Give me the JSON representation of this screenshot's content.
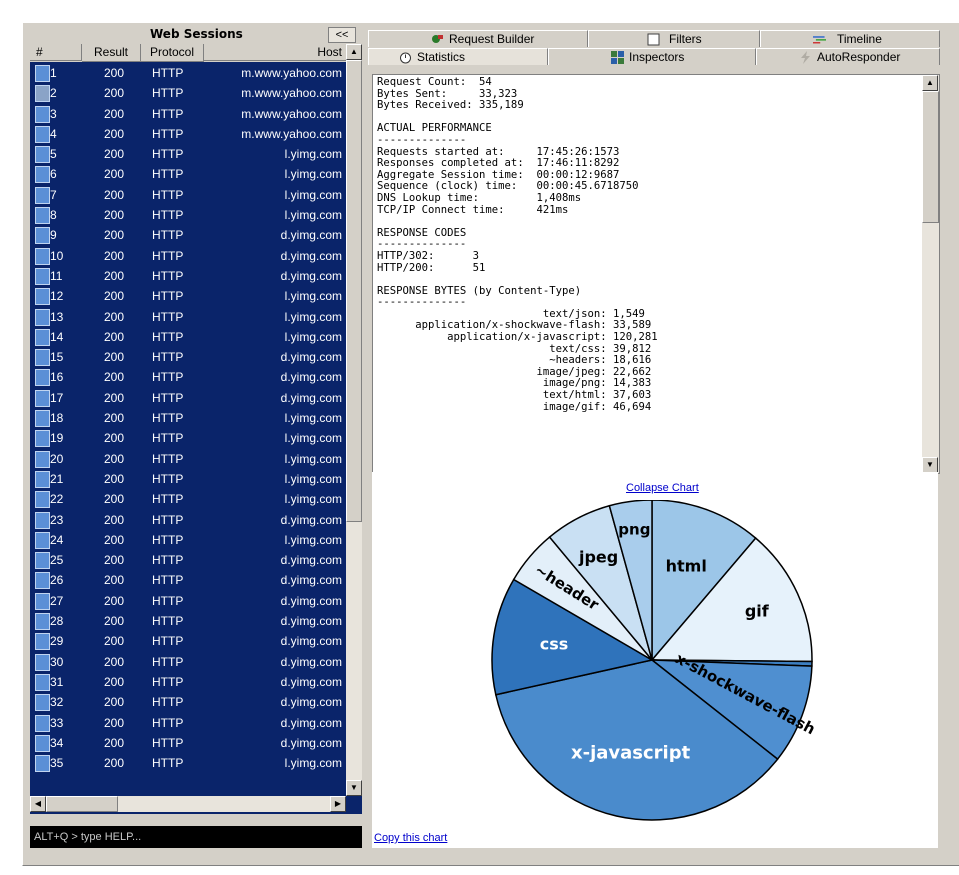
{
  "left_pane": {
    "title": "Web Sessions",
    "collapse_label": "<<",
    "columns": [
      "#",
      "Result",
      "Protocol",
      "Host"
    ],
    "rows": [
      {
        "num": "1",
        "result": "200",
        "protocol": "HTTP",
        "host": "m.www.yahoo.com"
      },
      {
        "num": "2",
        "result": "200",
        "protocol": "HTTP",
        "host": "m.www.yahoo.com"
      },
      {
        "num": "3",
        "result": "200",
        "protocol": "HTTP",
        "host": "m.www.yahoo.com"
      },
      {
        "num": "4",
        "result": "200",
        "protocol": "HTTP",
        "host": "m.www.yahoo.com"
      },
      {
        "num": "5",
        "result": "200",
        "protocol": "HTTP",
        "host": "l.yimg.com"
      },
      {
        "num": "6",
        "result": "200",
        "protocol": "HTTP",
        "host": "l.yimg.com"
      },
      {
        "num": "7",
        "result": "200",
        "protocol": "HTTP",
        "host": "l.yimg.com"
      },
      {
        "num": "8",
        "result": "200",
        "protocol": "HTTP",
        "host": "l.yimg.com"
      },
      {
        "num": "9",
        "result": "200",
        "protocol": "HTTP",
        "host": "d.yimg.com"
      },
      {
        "num": "10",
        "result": "200",
        "protocol": "HTTP",
        "host": "d.yimg.com"
      },
      {
        "num": "11",
        "result": "200",
        "protocol": "HTTP",
        "host": "d.yimg.com"
      },
      {
        "num": "12",
        "result": "200",
        "protocol": "HTTP",
        "host": "l.yimg.com"
      },
      {
        "num": "13",
        "result": "200",
        "protocol": "HTTP",
        "host": "l.yimg.com"
      },
      {
        "num": "14",
        "result": "200",
        "protocol": "HTTP",
        "host": "l.yimg.com"
      },
      {
        "num": "15",
        "result": "200",
        "protocol": "HTTP",
        "host": "d.yimg.com"
      },
      {
        "num": "16",
        "result": "200",
        "protocol": "HTTP",
        "host": "d.yimg.com"
      },
      {
        "num": "17",
        "result": "200",
        "protocol": "HTTP",
        "host": "d.yimg.com"
      },
      {
        "num": "18",
        "result": "200",
        "protocol": "HTTP",
        "host": "l.yimg.com"
      },
      {
        "num": "19",
        "result": "200",
        "protocol": "HTTP",
        "host": "l.yimg.com"
      },
      {
        "num": "20",
        "result": "200",
        "protocol": "HTTP",
        "host": "l.yimg.com"
      },
      {
        "num": "21",
        "result": "200",
        "protocol": "HTTP",
        "host": "l.yimg.com"
      },
      {
        "num": "22",
        "result": "200",
        "protocol": "HTTP",
        "host": "l.yimg.com"
      },
      {
        "num": "23",
        "result": "200",
        "protocol": "HTTP",
        "host": "d.yimg.com"
      },
      {
        "num": "24",
        "result": "200",
        "protocol": "HTTP",
        "host": "l.yimg.com"
      },
      {
        "num": "25",
        "result": "200",
        "protocol": "HTTP",
        "host": "d.yimg.com"
      },
      {
        "num": "26",
        "result": "200",
        "protocol": "HTTP",
        "host": "d.yimg.com"
      },
      {
        "num": "27",
        "result": "200",
        "protocol": "HTTP",
        "host": "d.yimg.com"
      },
      {
        "num": "28",
        "result": "200",
        "protocol": "HTTP",
        "host": "d.yimg.com"
      },
      {
        "num": "29",
        "result": "200",
        "protocol": "HTTP",
        "host": "d.yimg.com"
      },
      {
        "num": "30",
        "result": "200",
        "protocol": "HTTP",
        "host": "d.yimg.com"
      },
      {
        "num": "31",
        "result": "200",
        "protocol": "HTTP",
        "host": "d.yimg.com"
      },
      {
        "num": "32",
        "result": "200",
        "protocol": "HTTP",
        "host": "d.yimg.com"
      },
      {
        "num": "33",
        "result": "200",
        "protocol": "HTTP",
        "host": "d.yimg.com"
      },
      {
        "num": "34",
        "result": "200",
        "protocol": "HTTP",
        "host": "d.yimg.com"
      },
      {
        "num": "35",
        "result": "200",
        "protocol": "HTTP",
        "host": "l.yimg.com"
      }
    ],
    "quickexec": "ALT+Q > type HELP..."
  },
  "tabs": {
    "row1": [
      {
        "label": "Request Builder",
        "icon": "request-builder-icon"
      },
      {
        "label": "Filters",
        "icon": "checkbox-icon"
      },
      {
        "label": "Timeline",
        "icon": "timeline-icon"
      }
    ],
    "row2": [
      {
        "label": "Statistics",
        "icon": "stopwatch-icon"
      },
      {
        "label": "Inspectors",
        "icon": "inspectors-icon"
      },
      {
        "label": "AutoResponder",
        "icon": "lightning-icon"
      }
    ],
    "active": "Statistics"
  },
  "statistics": {
    "summary": [
      {
        "k": "Request Count:",
        "v": "54"
      },
      {
        "k": "Bytes Sent:",
        "v": "33,323"
      },
      {
        "k": "Bytes Received:",
        "v": "335,189"
      }
    ],
    "performance_title": "ACTUAL PERFORMANCE",
    "performance": [
      {
        "k": "Requests started at:",
        "v": "17:45:26:1573"
      },
      {
        "k": "Responses completed at:",
        "v": "17:46:11:8292"
      },
      {
        "k": "Aggregate Session time:",
        "v": "00:00:12:9687"
      },
      {
        "k": "Sequence (clock) time:",
        "v": "00:00:45.6718750"
      },
      {
        "k": "DNS Lookup time:",
        "v": "1,408ms"
      },
      {
        "k": "TCP/IP Connect time:",
        "v": "421ms"
      }
    ],
    "codes_title": "RESPONSE CODES",
    "codes": [
      {
        "k": "HTTP/302:",
        "v": "3"
      },
      {
        "k": "HTTP/200:",
        "v": "51"
      }
    ],
    "bytes_title": "RESPONSE BYTES (by Content-Type)",
    "bytes": [
      {
        "k": "text/json:",
        "v": "1,549"
      },
      {
        "k": "application/x-shockwave-flash:",
        "v": "33,589"
      },
      {
        "k": "application/x-javascript:",
        "v": "120,281"
      },
      {
        "k": "text/css:",
        "v": "39,812"
      },
      {
        "k": "~headers:",
        "v": "18,616"
      },
      {
        "k": "image/jpeg:",
        "v": "22,662"
      },
      {
        "k": "image/png:",
        "v": "14,383"
      },
      {
        "k": "text/html:",
        "v": "37,603"
      },
      {
        "k": "image/gif:",
        "v": "46,694"
      }
    ]
  },
  "links": {
    "collapse_chart": "Collapse Chart",
    "copy_chart": "Copy this chart"
  },
  "chart_data": {
    "type": "pie",
    "slices": [
      {
        "label": "html",
        "value": 37603,
        "color": "#9cc6e8"
      },
      {
        "label": "gif",
        "value": 46694,
        "color": "#e6f2fb"
      },
      {
        "label": "",
        "value": 1549,
        "color": "#3d7fc1"
      },
      {
        "label": "x-shockwave-flash",
        "value": 33589,
        "color": "#4f8fd0"
      },
      {
        "label": "x-javascript",
        "value": 120281,
        "color": "#4a8bcc"
      },
      {
        "label": "css",
        "value": 39812,
        "color": "#2f73bb"
      },
      {
        "label": "~header",
        "value": 18616,
        "color": "#e3eff9"
      },
      {
        "label": "jpeg",
        "value": 22662,
        "color": "#c9e0f3"
      },
      {
        "label": "png",
        "value": 14383,
        "color": "#a9cdec"
      }
    ]
  }
}
